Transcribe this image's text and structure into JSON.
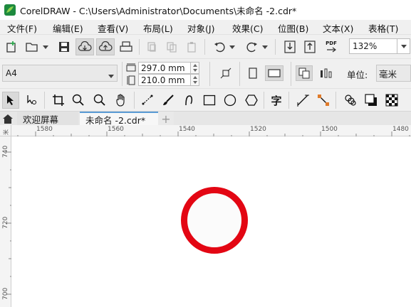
{
  "window": {
    "title": "CorelDRAW - C:\\Users\\Administrator\\Documents\\未命名 -2.cdr*"
  },
  "menu": {
    "file": "文件(F)",
    "edit": "编辑(E)",
    "view": "查看(V)",
    "layout": "布局(L)",
    "object": "对象(J)",
    "effects": "效果(C)",
    "bitmaps": "位图(B)",
    "text": "文本(X)",
    "table": "表格(T)"
  },
  "toolbar": {
    "zoom_value": "132%",
    "pdf_label": "PDF"
  },
  "property_bar": {
    "page_size": "A4",
    "page_width": "297.0 mm",
    "page_height": "210.0 mm",
    "units_label": "单位:",
    "units_value": "毫米"
  },
  "toolbox": {
    "text_tool_glyph": "字"
  },
  "tabs": {
    "welcome": "欢迎屏幕",
    "document": "未命名 -2.cdr*",
    "add": "+"
  },
  "rulers": {
    "corner_label": "米",
    "horizontal": [
      "1580",
      "1560",
      "1540",
      "1520",
      "1500",
      "1480"
    ],
    "vertical": [
      "740",
      "720",
      "700"
    ]
  },
  "colors": {
    "circle_outline": "#e30613",
    "circle_fill": "#fbfbfb",
    "app_logo": "#2fa84f"
  }
}
